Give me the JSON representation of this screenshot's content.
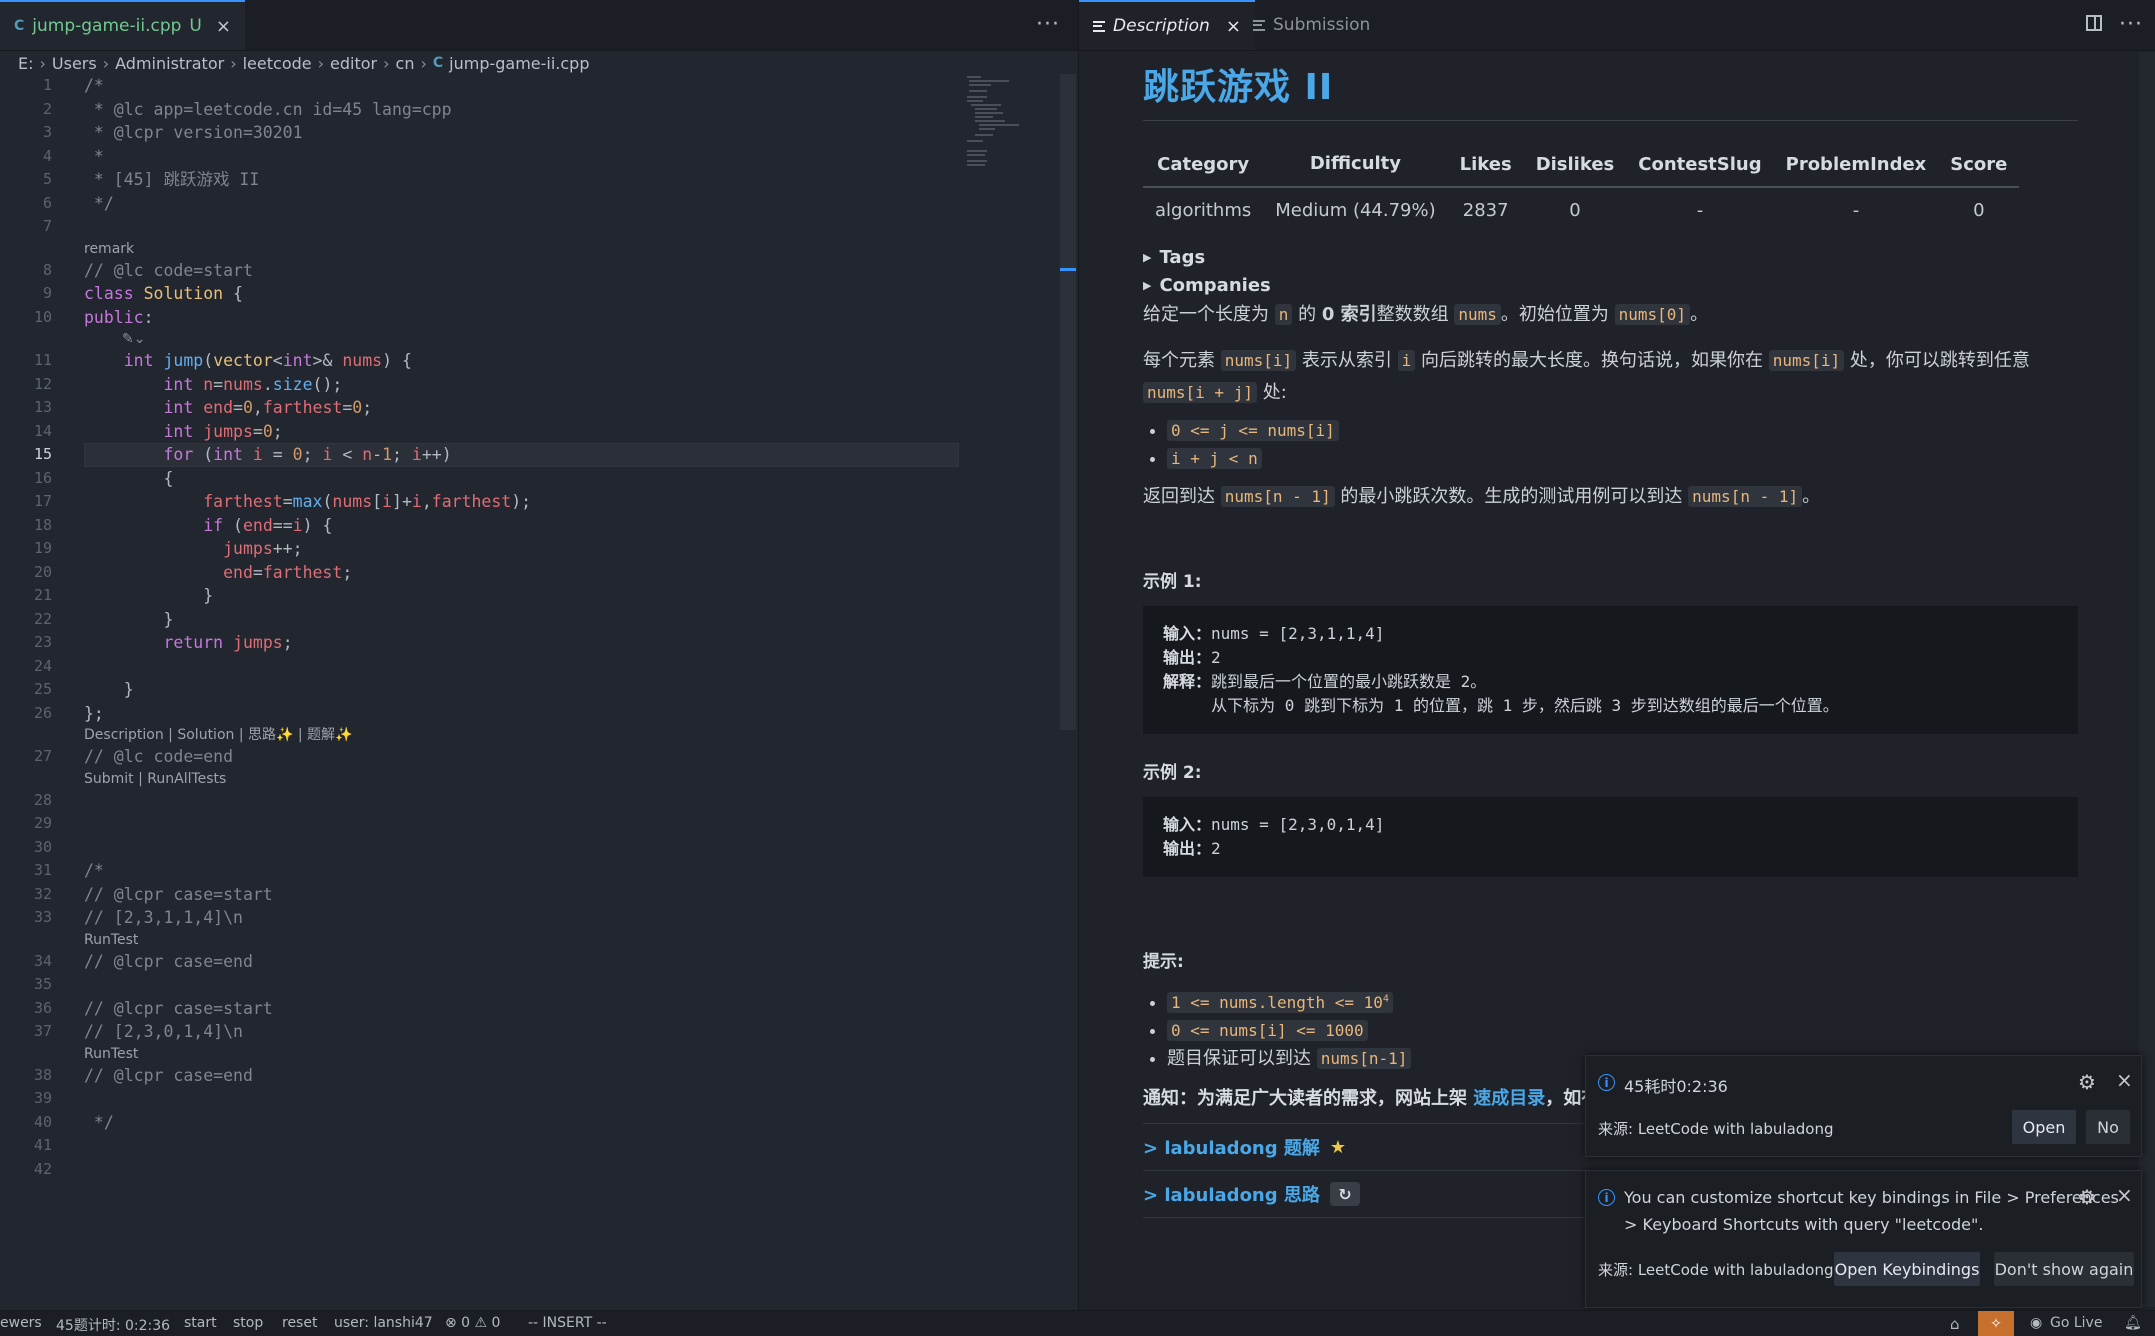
{
  "editor": {
    "tab": {
      "file_icon": "C",
      "name": "jump-game-ii.cpp",
      "status": "U",
      "close": "×"
    },
    "more": "···",
    "breadcrumb": [
      "E:",
      "Users",
      "Administrator",
      "leetcode",
      "editor",
      "cn"
    ],
    "breadcrumb_file": "jump-game-ii.cpp",
    "breadcrumb_icon": "C",
    "lens_remark": "remark",
    "lens_desc": "Description | Solution | 思路✨ | 题解✨",
    "lens_submit": "Submit | RunAllTests",
    "lens_runtest": "RunTest",
    "current_line": "15"
  },
  "doc_tabs": {
    "description": "Description",
    "submission": "Submission",
    "close": "×",
    "more": "···"
  },
  "problem": {
    "title": "跳跃游戏 II",
    "table_headers": [
      "Category",
      "Difficulty",
      "Likes",
      "Dislikes",
      "ContestSlug",
      "ProblemIndex",
      "Score"
    ],
    "table_row": [
      "algorithms",
      "Medium (44.79%)",
      "2837",
      "0",
      "-",
      "-",
      "0"
    ],
    "tags": "Tags",
    "companies": "Companies",
    "example1_label": "示例 1:",
    "example2_label": "示例 2:",
    "hint_label": "提示:",
    "labuladong_solution": "> labuladong 题解",
    "labuladong_idea": "> labuladong 思路"
  },
  "toasts": [
    {
      "message": "45耗时0:2:36",
      "source": "来源: LeetCode with labuladong",
      "btn1": "Open",
      "btn2": "No"
    },
    {
      "message": "You can customize shortcut key bindings in File > Preferences",
      "message2": "> Keyboard Shortcuts with query \"leetcode\".",
      "source": "来源: LeetCode with labuladong",
      "btn1": "Open Keybindings",
      "btn2": "Don't show again"
    }
  ],
  "statusbar": {
    "items": [
      "ewers",
      "45题计时: 0:2:36",
      "start",
      "stop",
      "reset",
      "user: lanshi47",
      "⊗ 0 ⚠ 0",
      "-- INSERT --"
    ],
    "golive": "Go Live"
  }
}
